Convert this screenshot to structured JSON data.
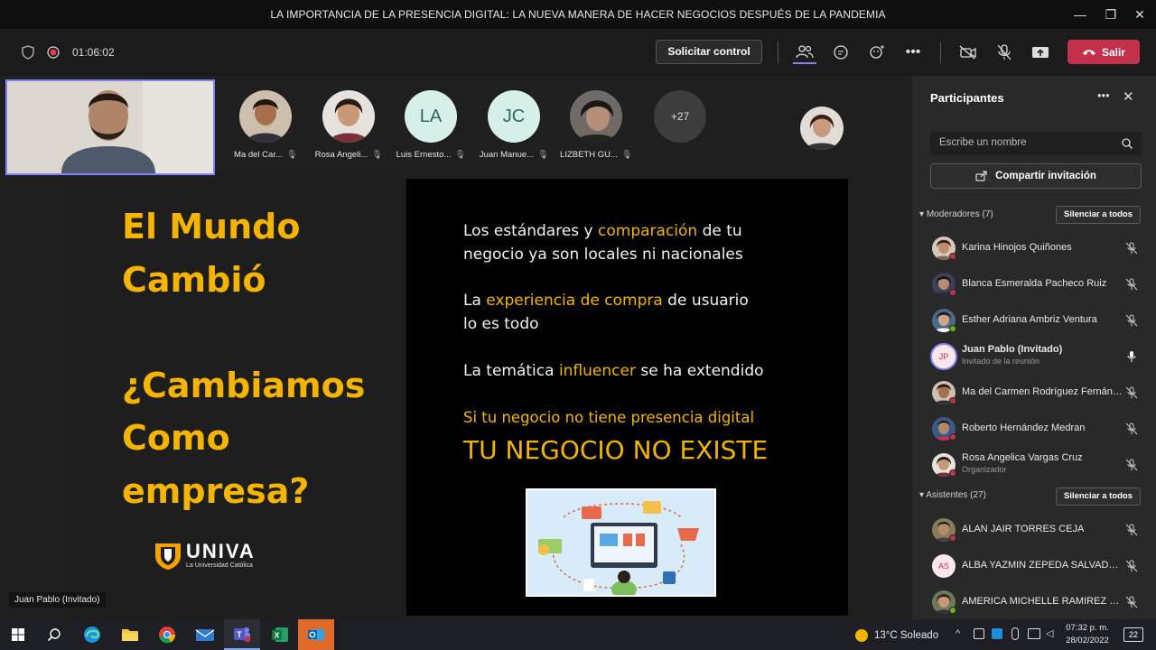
{
  "window": {
    "title": "LA IMPORTANCIA DE LA PRESENCIA DIGITAL: LA NUEVA MANERA DE HACER NEGOCIOS DESPUÉS DE LA PANDEMIA",
    "minimize_glyph": "—",
    "restore_glyph": "❐",
    "close_glyph": "✕"
  },
  "toolbar": {
    "timer": "01:06:02",
    "request_control_label": "Solicitar control",
    "leave_label": "Salir",
    "leave_color": "#c4314b"
  },
  "stage": {
    "speaker_label": "Juan Pablo (Invitado)",
    "more_participants": "+27",
    "avatars": [
      {
        "label": "Ma del Car...",
        "type": "photo",
        "color": "#5a3a2e"
      },
      {
        "label": "Rosa Angeli...",
        "type": "photo",
        "color": "#8a5a40"
      },
      {
        "label": "Luis Ernesto...",
        "type": "initials",
        "initials": "LA"
      },
      {
        "label": "Juan Manue...",
        "type": "initials",
        "initials": "JC"
      },
      {
        "label": "LIZBETH GU...",
        "type": "photo",
        "color": "#3a3a3a"
      }
    ]
  },
  "slide": {
    "heading_1": "El Mundo",
    "heading_2": "Cambió",
    "heading_3": "¿Cambiamos",
    "heading_4": "Como",
    "heading_5": "empresa?",
    "logo_text": "UNIVA",
    "logo_subtext": "La Universidad Católica",
    "p1_a": "Los estándares y ",
    "p1_hl": "comparación",
    "p1_b": " de tu",
    "p1_line2": "negocio ya son locales ni nacionales",
    "p2_a": "La ",
    "p2_hl": "experiencia de compra",
    "p2_b": " de usuario",
    "p2_line2": "lo es todo",
    "p3_a": "La temática ",
    "p3_hl": "influencer",
    "p3_b": " se ha extendido",
    "p4": "Si tu negocio no tiene presencia digital",
    "p5": "TU NEGOCIO NO EXISTE",
    "accent_color": "#f4b400"
  },
  "panel": {
    "title": "Participantes",
    "search_placeholder": "Escribe un nombre",
    "share_label": "Compartir invitación",
    "moderators_label": "Moderadores (7)",
    "attendees_label": "Asistentes (27)",
    "mute_all_label": "Silenciar a todos",
    "moderators": [
      {
        "name": "Karina Hinojos Quiñones",
        "sub": "",
        "status": "#c4314b",
        "mic": "muted"
      },
      {
        "name": "Blanca Esmeralda Pacheco Ruiz",
        "sub": "",
        "status": "#c4314b",
        "mic": "muted"
      },
      {
        "name": "Esther Adriana Ambriz Ventura",
        "sub": "",
        "status": "#6bb700",
        "mic": "muted"
      },
      {
        "name": "Juan Pablo (Invitado)",
        "sub": "Invitado de la reunión",
        "status": "",
        "mic": "on",
        "initials": "JP"
      },
      {
        "name": "Ma del Carmen Rodríguez Fernández",
        "sub": "",
        "status": "#c4314b",
        "mic": "muted"
      },
      {
        "name": "Roberto Hernández Medran",
        "sub": "",
        "status": "#c4314b",
        "mic": "muted"
      },
      {
        "name": "Rosa Angelica Vargas Cruz",
        "sub": "Organizador",
        "status": "#c4314b",
        "mic": "muted"
      }
    ],
    "attendees": [
      {
        "name": "ALAN JAIR TORRES CEJA",
        "sub": "",
        "status": "#c4314b",
        "mic": "muted"
      },
      {
        "name": "ALBA YAZMIN ZEPEDA SALVADOR",
        "sub": "",
        "status": "",
        "mic": "muted",
        "initials": "AS"
      },
      {
        "name": "AMERICA MICHELLE RAMIREZ CASTILLO",
        "sub": "",
        "status": "#6bb700",
        "mic": "muted"
      }
    ]
  },
  "taskbar": {
    "weather": "13°C  Soleado",
    "time": "07:32 p. m.",
    "date": "28/02/2022",
    "notifications": "22"
  }
}
